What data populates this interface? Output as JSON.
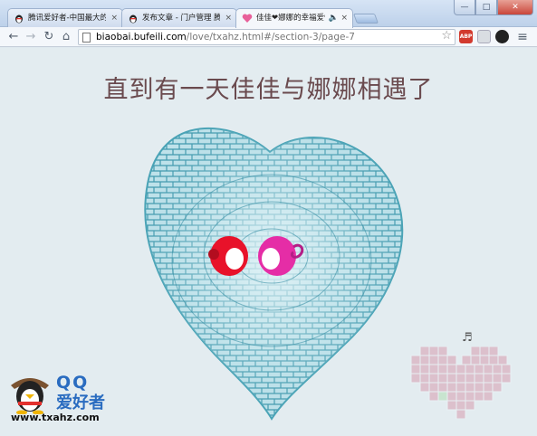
{
  "browser": {
    "tabs": [
      {
        "label": "腾讯爱好者-中国最大的QQ",
        "active": false
      },
      {
        "label": "发布文章 - 门户管理 腾讯",
        "active": false
      },
      {
        "label": "佳佳❤娜娜的幸福爱情",
        "active": true
      }
    ],
    "tab_close_glyph": "×",
    "audio_glyph": "🔈",
    "window": {
      "minimize": "—",
      "maximize": "□",
      "close": "✕"
    },
    "nav": {
      "back": "←",
      "forward": "→",
      "reload": "↻",
      "home": "⌂"
    },
    "url_host": "biaobai.bufeili.com",
    "url_path": "/love/txahz.html#/section-3/page-7",
    "bookmark_star": "☆",
    "extensions": [
      "ABP",
      "",
      ""
    ],
    "menu_glyph": "≡"
  },
  "page": {
    "headline": "直到有一天佳佳与娜娜相遇了",
    "music_note": "♬"
  },
  "logo": {
    "qq": "QQ",
    "name": "爱好者",
    "url": "www.txahz.com"
  },
  "colors": {
    "headline": "#6a4a4e",
    "mosaic": "#5aa9b8",
    "pixel_heart": "#dcc0cc",
    "pixel_heart_highlight": "#c8e4cf",
    "char_red": "#e8122a",
    "char_pink": "#e52da6",
    "logo_blue": "#2a6cc0"
  }
}
